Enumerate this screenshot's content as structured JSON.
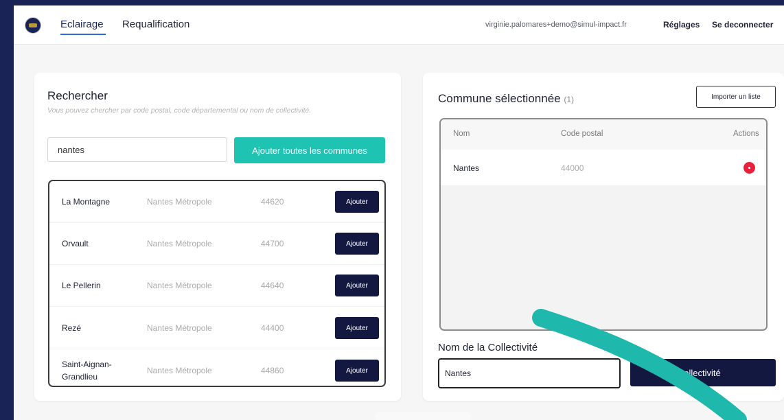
{
  "header": {
    "tabs": [
      {
        "label": "Eclairage",
        "active": true
      },
      {
        "label": "Requalification",
        "active": false
      }
    ],
    "user_email": "virginie.palomares+demo@simul-impact.fr",
    "settings_label": "Réglages",
    "logout_label": "Se deconnecter"
  },
  "search": {
    "title": "Rechercher",
    "hint": "Vous pouvez chercher par code postal, code départemental ou nom de collectivité.",
    "query": "nantes",
    "add_all_label": "Ajouter toutes les communes",
    "results": [
      {
        "name": "La Montagne",
        "region": "Nantes Métropole",
        "code": "44620",
        "button": "Ajouter"
      },
      {
        "name": "Orvault",
        "region": "Nantes Métropole",
        "code": "44700",
        "button": "Ajouter"
      },
      {
        "name": "Le Pellerin",
        "region": "Nantes Métropole",
        "code": "44640",
        "button": "Ajouter"
      },
      {
        "name": "Rezé",
        "region": "Nantes Métropole",
        "code": "44400",
        "button": "Ajouter"
      },
      {
        "name": "Saint-Aignan-Grandlieu",
        "region": "Nantes Métropole",
        "code": "44860",
        "button": "Ajouter"
      }
    ]
  },
  "selection": {
    "title": "Commune sélectionnée",
    "count": "(1)",
    "import_label": "Importer un liste",
    "columns": [
      "Nom",
      "Code postal",
      "Actions"
    ],
    "rows": [
      {
        "name": "Nantes",
        "code": "44000"
      }
    ],
    "collectivite_label": "Nom de la Collectivité",
    "collectivite_value": "Nantes",
    "create_label": "la collectivité"
  },
  "colors": {
    "background": "#1a2355",
    "accent_teal": "#1ec3b2",
    "navy_button": "#121840",
    "remove_red": "#e8213a",
    "annotation_teal": "#1eb8ad"
  }
}
